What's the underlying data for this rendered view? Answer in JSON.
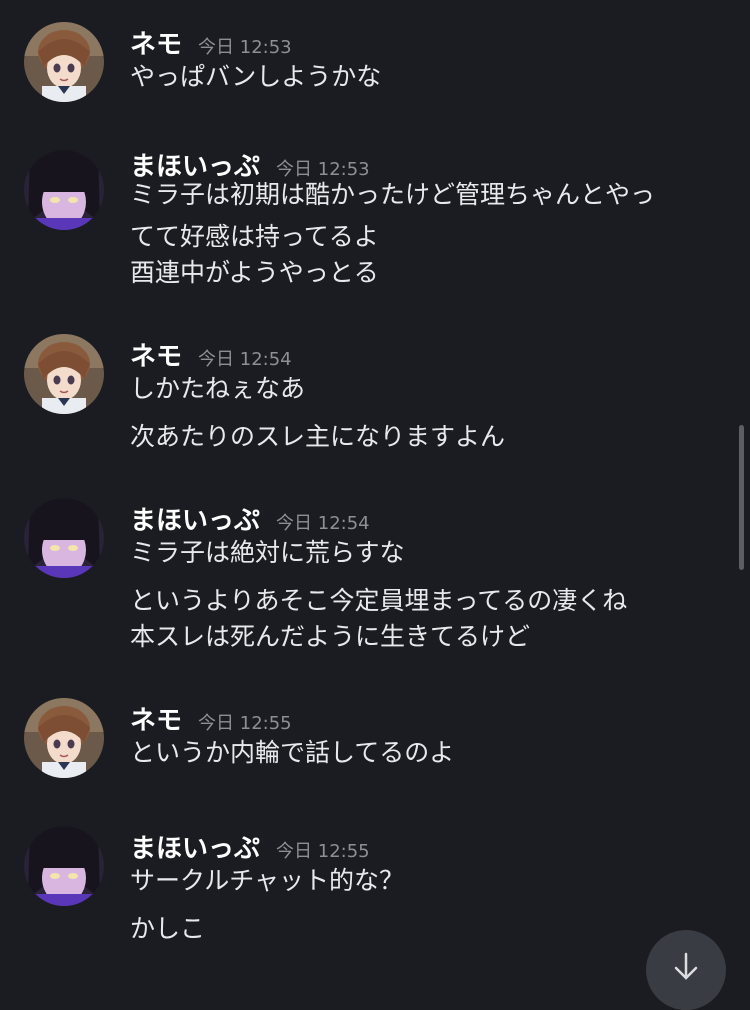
{
  "messages": [
    {
      "author": "ネモ",
      "time": "今日 12:53",
      "lines": [
        "やっぱバンしようかな"
      ]
    },
    {
      "author": "まほいっぷ",
      "time": "今日 12:53",
      "lines": [
        "ミラ子は初期は酷かったけど管理ちゃんとやっ",
        "てて好感は持ってるよ",
        "酉連中がようやっとる"
      ]
    },
    {
      "author": "ネモ",
      "time": "今日 12:54",
      "lines": [
        "しかたねぇなあ",
        "次あたりのスレ主になりますよん"
      ]
    },
    {
      "author": "まほいっぷ",
      "time": "今日 12:54",
      "lines": [
        "ミラ子は絶対に荒らすな",
        "というよりあそこ今定員埋まってるの凄くね",
        "本スレは死んだように生きてるけど"
      ]
    },
    {
      "author": "ネモ",
      "time": "今日 12:55",
      "lines": [
        "というか内輪で話してるのよ"
      ]
    },
    {
      "author": "まほいっぷ",
      "time": "今日 12:55",
      "lines": [
        "サークルチャット的な？",
        "かしこ"
      ]
    }
  ],
  "icons": {
    "nemo_avatar": "anime-girl-brown-hair-avatar",
    "mahoippu_avatar": "anime-girl-dark-hair-avatar",
    "jump": "arrow-down-icon"
  },
  "colors": {
    "background": "#1b1c21",
    "username": "#ffffff",
    "timestamp": "#8d8f97",
    "text": "#e8e9ec"
  }
}
